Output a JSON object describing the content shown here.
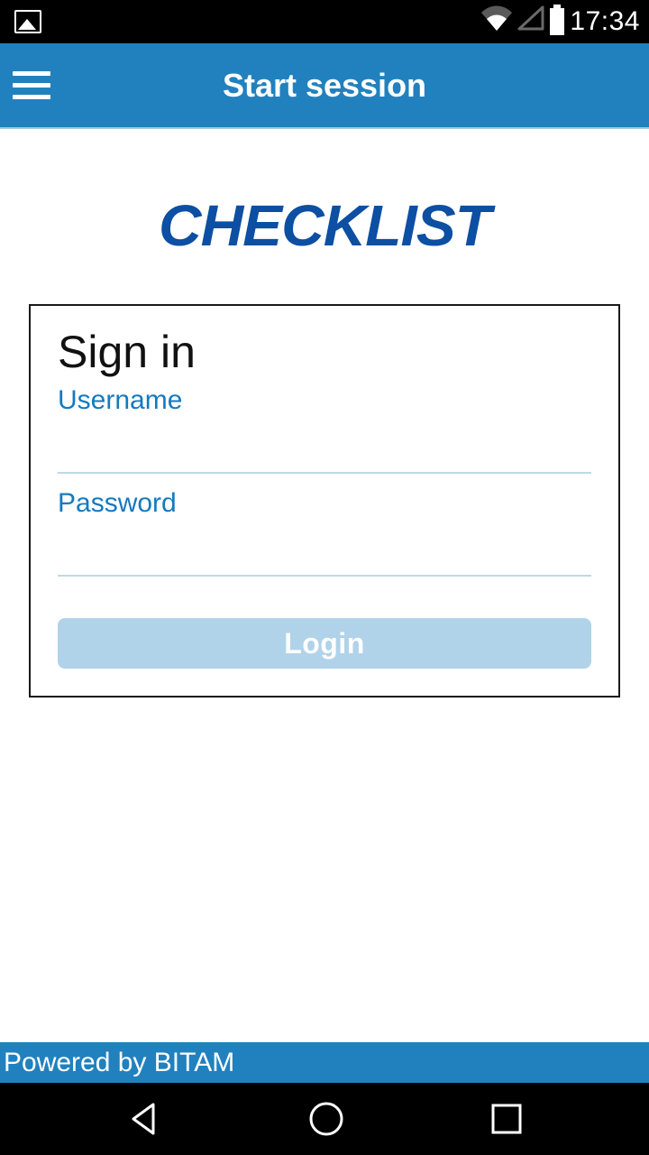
{
  "status_bar": {
    "time": "17:34"
  },
  "header": {
    "title": "Start session"
  },
  "brand": "CHECKLIST",
  "signin": {
    "heading": "Sign in",
    "username_label": "Username",
    "username_value": "",
    "password_label": "Password",
    "password_value": "",
    "login_label": "Login"
  },
  "footer": {
    "text": "Powered by BITAM"
  },
  "colors": {
    "header_bg": "#2181be",
    "brand": "#0c4fa3",
    "label": "#157abf",
    "login_btn_bg": "#b0d3ea"
  }
}
